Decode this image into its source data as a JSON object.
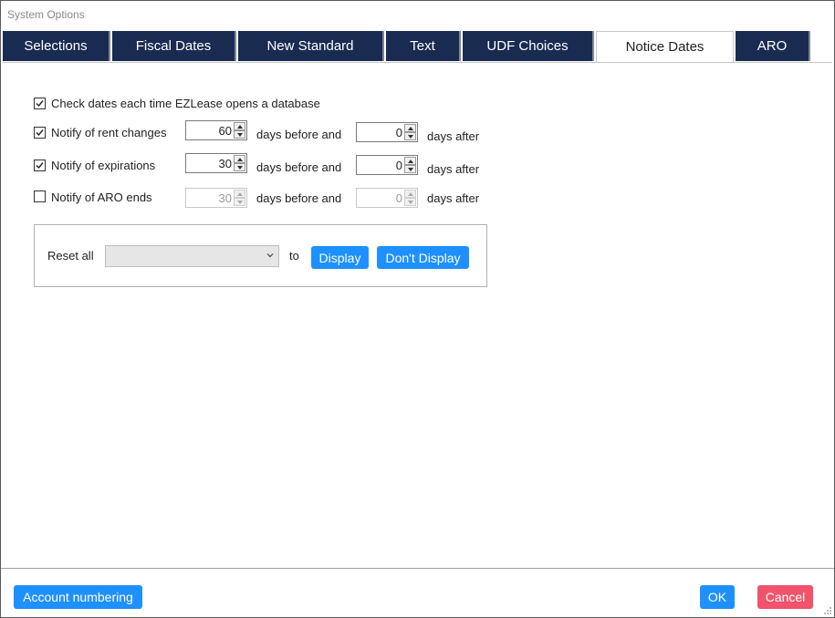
{
  "window": {
    "title": "System Options"
  },
  "tabs": [
    {
      "label": "Selections"
    },
    {
      "label": "Fiscal Dates"
    },
    {
      "label": "New Standard"
    },
    {
      "label": "Text"
    },
    {
      "label": "UDF Choices"
    },
    {
      "label": "Notice Dates",
      "active": true
    },
    {
      "label": "ARO"
    }
  ],
  "options": {
    "check_dates": {
      "label": "Check dates each time EZLease opens a database",
      "checked": true
    },
    "rent_changes": {
      "label": "Notify of rent changes",
      "checked": true,
      "before": "60",
      "after": "0"
    },
    "expirations": {
      "label": "Notify of expirations",
      "checked": true,
      "before": "30",
      "after": "0"
    },
    "aro_ends": {
      "label": "Notify of ARO ends",
      "checked": false,
      "before": "30",
      "after": "0",
      "disabled": true
    },
    "days_before_label": "days before and",
    "days_after_label": "days after"
  },
  "reset": {
    "label": "Reset all",
    "selected": "",
    "to_label": "to",
    "display_button": "Display",
    "dont_display_button": "Don't Display"
  },
  "footer": {
    "account_numbering": "Account numbering",
    "ok": "OK",
    "cancel": "Cancel"
  },
  "colors": {
    "tab_background": "#1a2b52",
    "primary_button": "#1e90ff",
    "cancel_button": "#f0536b"
  }
}
